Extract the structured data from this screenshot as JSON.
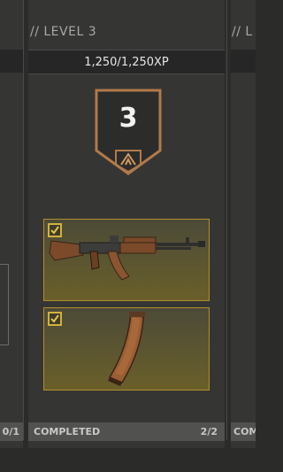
{
  "level": {
    "label": "// LEVEL 3",
    "xp": "1,250/1,250XP",
    "number": "3"
  },
  "right_level_label": "// L",
  "rewards": [
    {
      "name": "AK-style assault rifle",
      "checked": true
    },
    {
      "name": "Curved magazine",
      "checked": true
    }
  ],
  "footer": {
    "status": "COMPLETED",
    "progress": "2/2",
    "left_progress": "0/1",
    "right_status": "COM"
  },
  "colors": {
    "card_border": "#b08f2c",
    "badge_border": "#b07a4a",
    "check": "#d2b23b"
  }
}
